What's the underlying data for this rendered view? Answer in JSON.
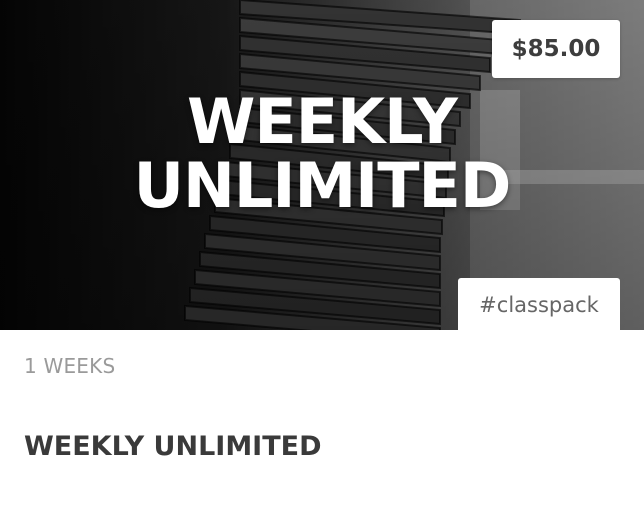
{
  "hero": {
    "title_line1": "WEEKLY",
    "title_line2": "UNLIMITED"
  },
  "price_badge": "$85.00",
  "tag_badge": "#classpack",
  "details": {
    "duration": "1 WEEKS",
    "title": "WEEKLY UNLIMITED"
  },
  "colors": {
    "badge_background": "#ffffff",
    "price_text": "#3d3d3d",
    "tag_text": "#666666",
    "duration_text": "#9a9a9a",
    "title_text": "#3a3a3a"
  }
}
